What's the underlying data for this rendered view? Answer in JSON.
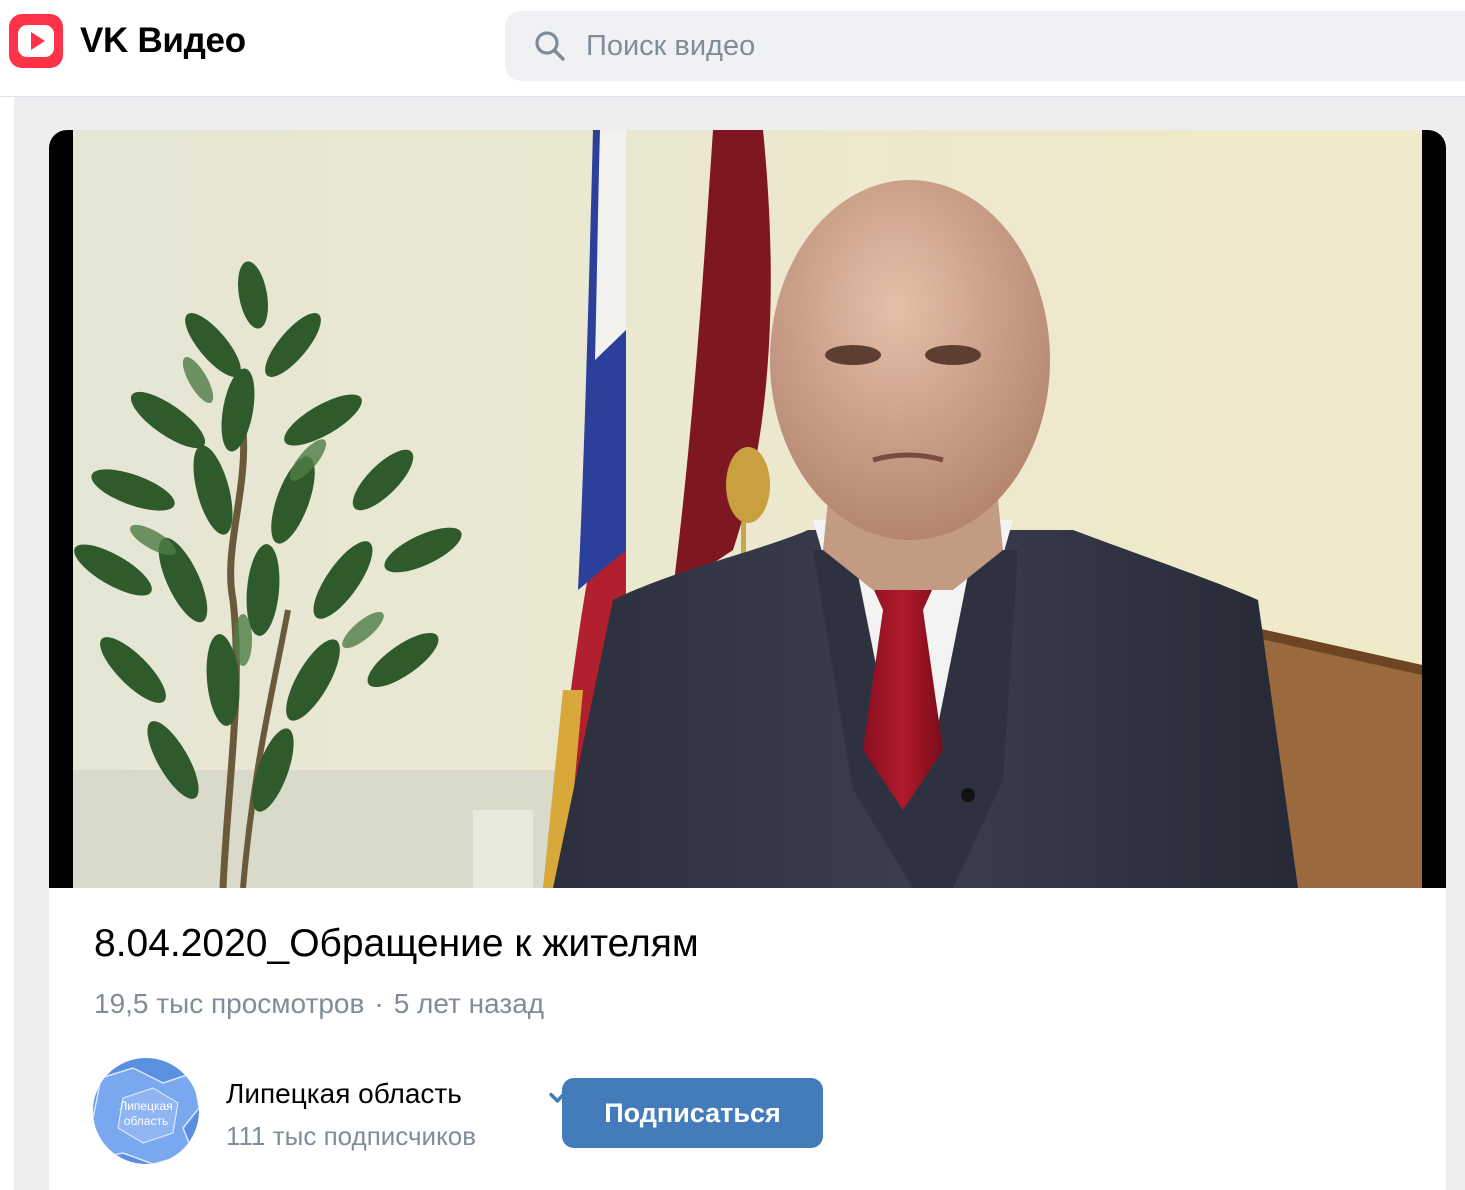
{
  "app": {
    "title": "VK Видео",
    "accent_color": "#ff3347"
  },
  "search": {
    "placeholder": "Поиск видео",
    "icon": "search-icon"
  },
  "video": {
    "title": "8.04.2020_Обращение к жителям",
    "views": "19,5 тыс просмотров",
    "separator": "·",
    "age": "5 лет назад"
  },
  "channel": {
    "name": "Липецкая область",
    "verified": true,
    "subscribers": "111 тыс подписчиков",
    "avatar_label": "Липецкая область",
    "avatar_lines": [
      "Липецкая",
      "область"
    ]
  },
  "subscribe": {
    "label": "Подписаться",
    "color": "#447bba"
  }
}
